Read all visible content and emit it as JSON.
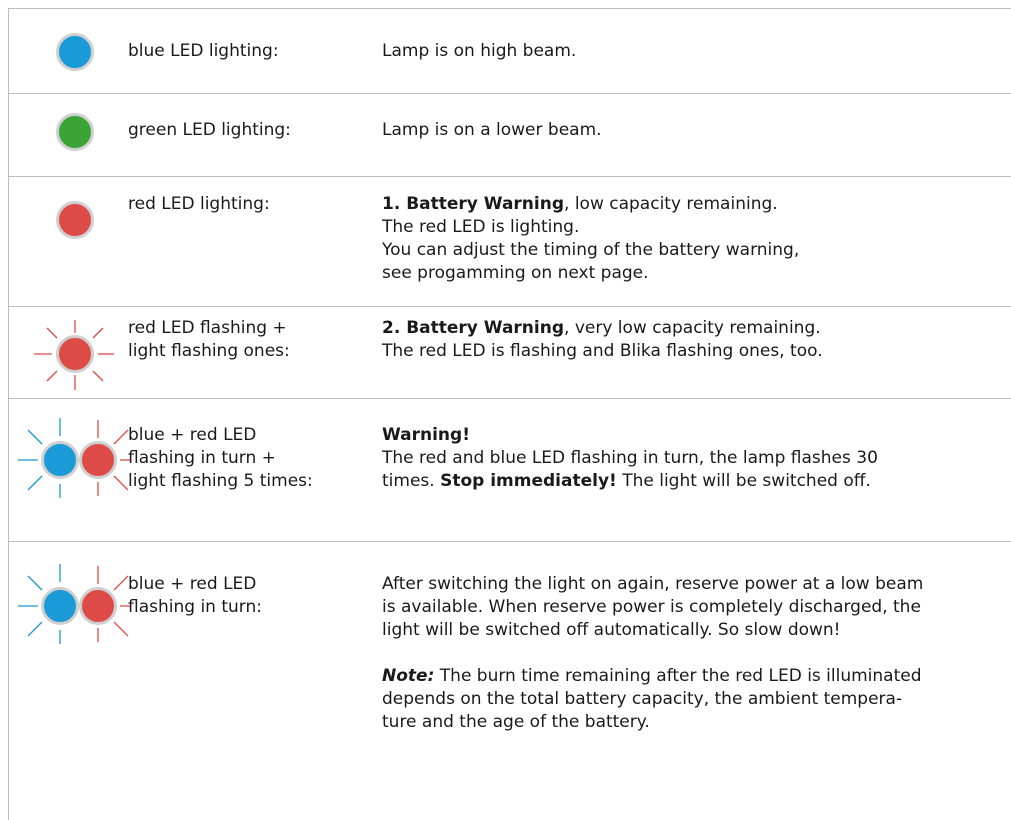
{
  "colors": {
    "blue": "#1a9ad6",
    "green": "#3aa535",
    "red": "#de4b47",
    "led_border": "#cfcfcf",
    "divider": "#bdbdbd"
  },
  "rows": [
    {
      "led": "blue-led-icon",
      "label_lines": [
        "blue LED lighting:"
      ],
      "desc": "Lamp is on high beam."
    },
    {
      "led": "green-led-icon",
      "label_lines": [
        "green LED lighting:"
      ],
      "desc": "Lamp is on a lower beam."
    },
    {
      "led": "red-led-icon",
      "label_lines": [
        "red LED lighting:"
      ],
      "desc_bold": "1. Battery Warning",
      "desc_rest": ", low capacity remaining.",
      "desc_lines": [
        "The red LED is lighting.",
        "You can adjust the timing of the battery warning,",
        "see progamming on next page."
      ]
    },
    {
      "led": "red-led-flashing-icon",
      "label_lines": [
        "red LED flashing +",
        "light flashing ones:"
      ],
      "desc_bold": "2. Battery Warning",
      "desc_rest": ", very low capacity remaining.",
      "desc_lines": [
        "The red LED is flashing and Blika flashing ones, too."
      ]
    },
    {
      "led": "blue-red-led-flashing-icon",
      "label_lines": [
        "blue + red LED",
        "flashing in turn +",
        "light flashing 5 times:"
      ],
      "desc_heading": "Warning!",
      "desc_line1": "The red and blue LED flashing in turn, the lamp flashes 30",
      "desc_line2_pre": "times. ",
      "desc_line2_bold": "Stop immediately!",
      "desc_line2_post": " The light will be switched off."
    },
    {
      "led": "blue-red-led-flashing-icon",
      "label_lines": [
        "blue + red LED",
        "flashing in turn:"
      ],
      "desc_lines": [
        "After switching the light on again, reserve power at a low beam",
        "is available. When reserve power is completely discharged, the",
        "light will be switched off automatically. So slow down!"
      ],
      "note_label": "Note:",
      "note_lines": [
        " The burn time remaining after the red LED is illuminated",
        "depends on the total battery capacity, the ambient tempera-",
        "ture and the age of the battery."
      ]
    }
  ]
}
